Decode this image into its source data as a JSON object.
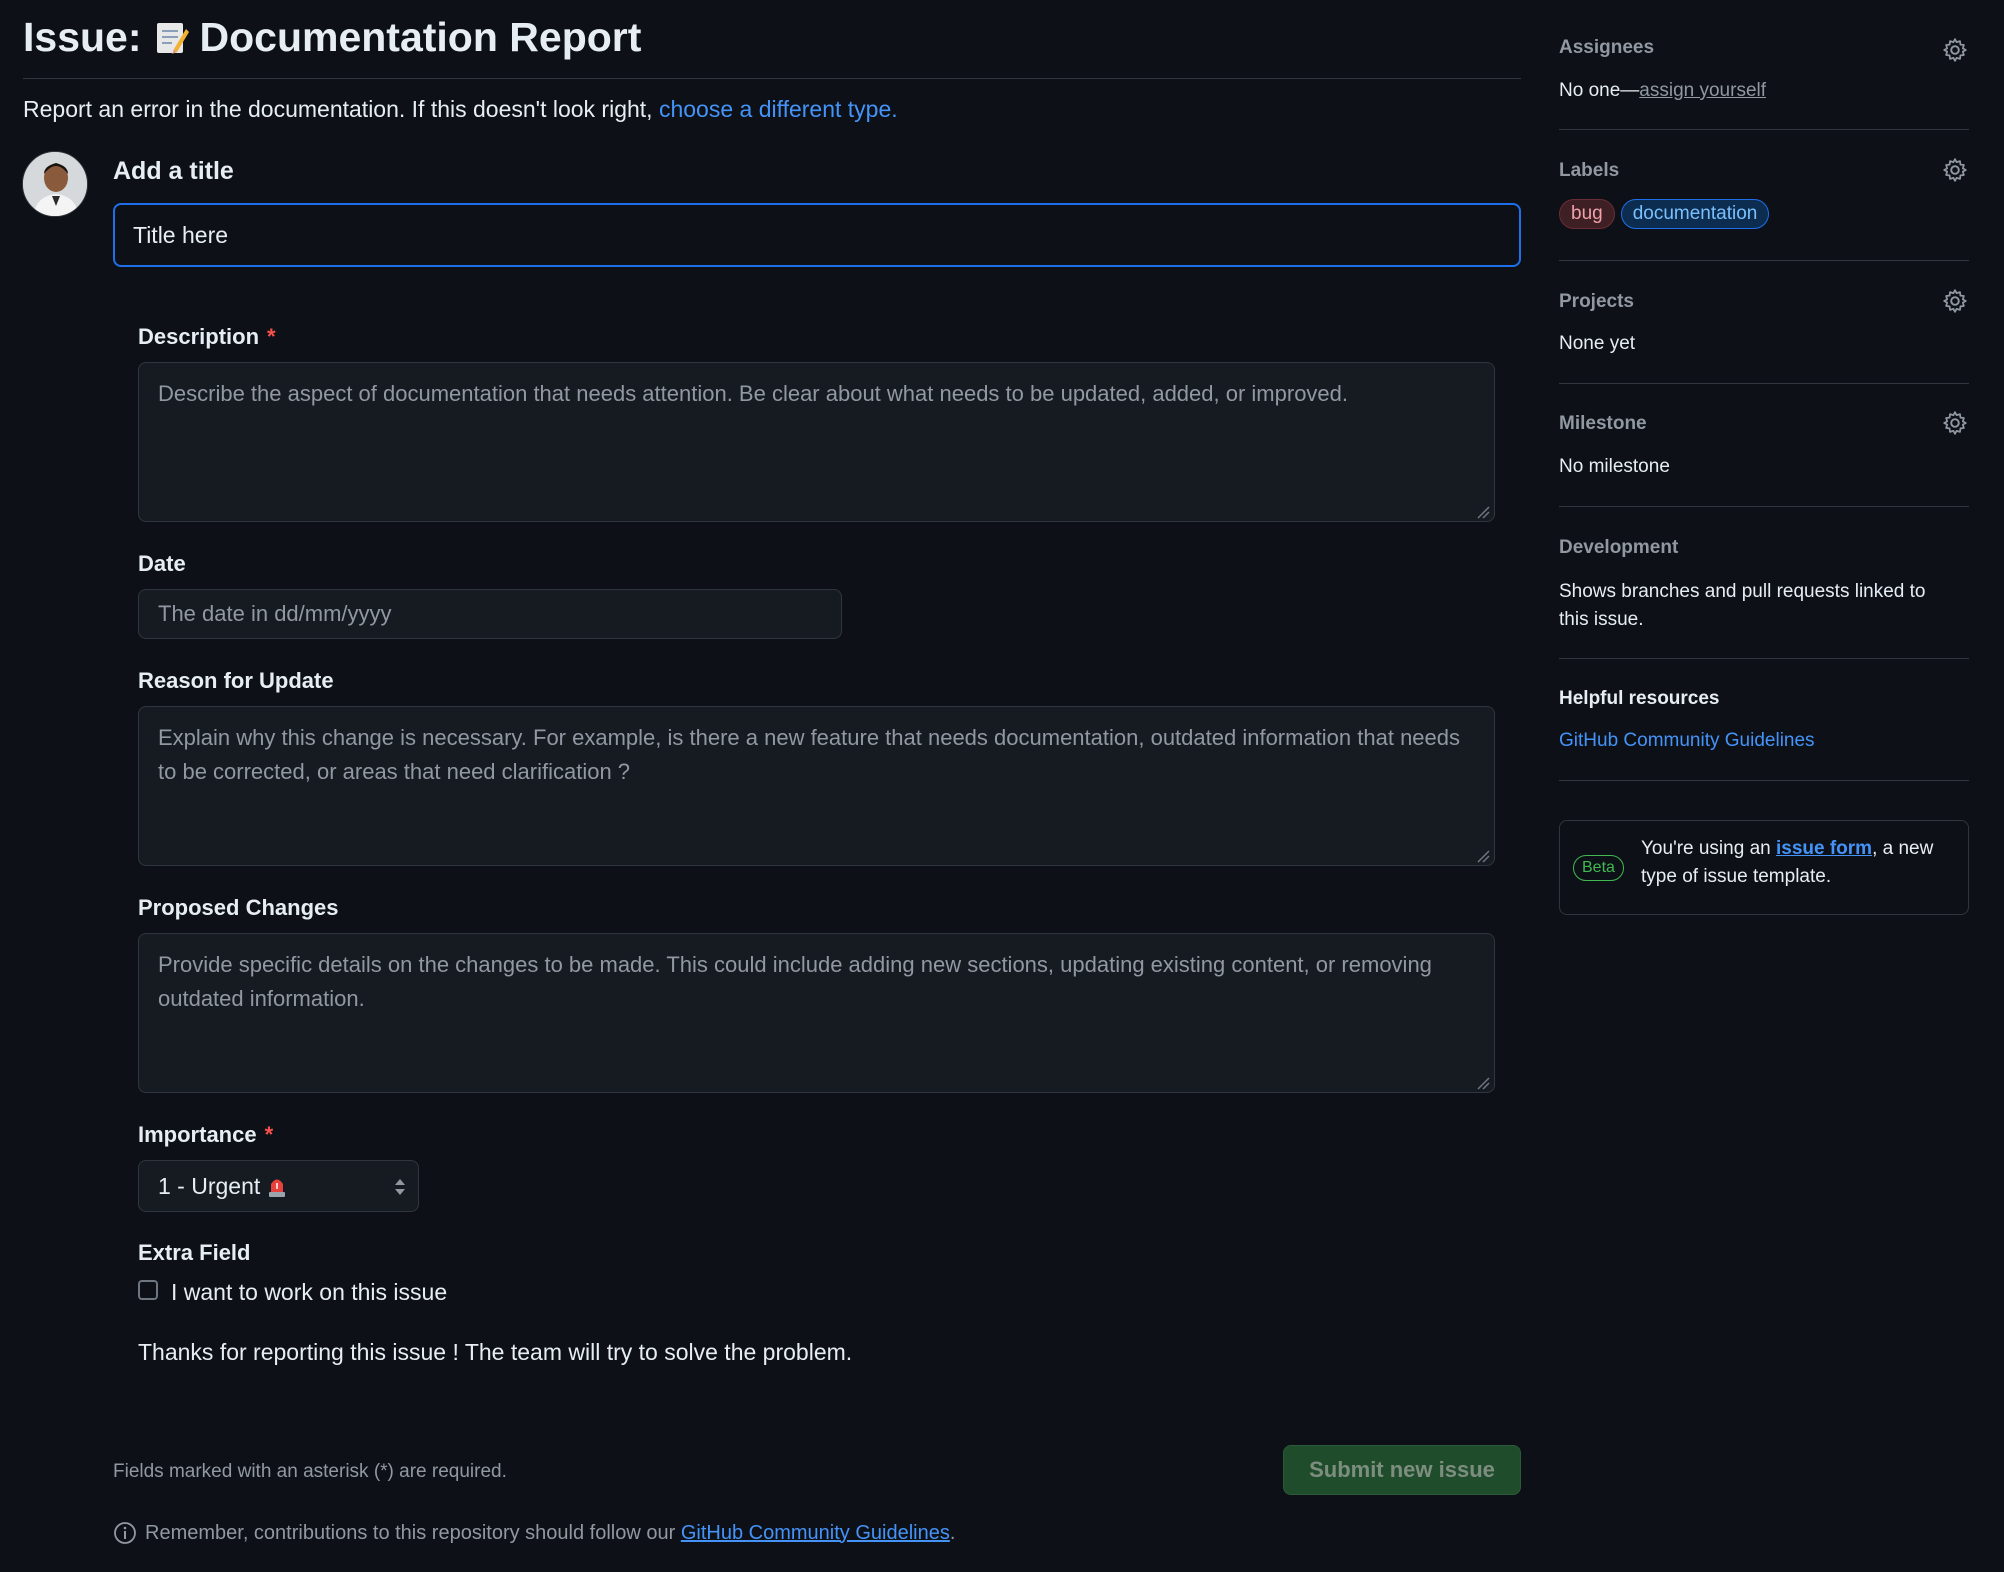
{
  "header": {
    "title_prefix": "Issue:",
    "title_emoji_icon": "memo-icon",
    "title_text": "Documentation Report",
    "subtitle": "Report an error in the documentation. If this doesn't look right,",
    "subtitle_link": "choose a different type."
  },
  "form": {
    "add_title_label": "Add a title",
    "title_value": "Title here",
    "description": {
      "label": "Description",
      "required_mark": "*",
      "placeholder": "Describe the aspect of documentation that needs attention. Be clear about what needs to be updated, added, or improved."
    },
    "date": {
      "label": "Date",
      "placeholder": "The date in dd/mm/yyyy"
    },
    "reason": {
      "label": "Reason for Update",
      "placeholder": "Explain why this change is necessary. For example, is there a new feature that needs documentation, outdated information that needs to be corrected, or areas that need clarification ?"
    },
    "proposed": {
      "label": "Proposed Changes",
      "placeholder": "Provide specific details on the changes to be made. This could include adding new sections, updating existing content, or removing outdated information."
    },
    "importance": {
      "label": "Importance",
      "required_mark": "*",
      "selected": "1 - Urgent",
      "selected_icon": "siren-icon"
    },
    "extra": {
      "label": "Extra Field",
      "checkbox_label": "I want to work on this issue",
      "checked": false
    },
    "thanks": "Thanks for reporting this issue ! The team will try to solve the problem.",
    "footnote": "Fields marked with an asterisk (*) are required.",
    "submit_label": "Submit new issue",
    "guidelines_prefix": "Remember, contributions to this repository should follow our",
    "guidelines_link": "GitHub Community Guidelines",
    "guidelines_suffix": "."
  },
  "sidebar": {
    "assignees": {
      "heading": "Assignees",
      "value_prefix": "No one—",
      "value_link": "assign yourself"
    },
    "labels": {
      "heading": "Labels",
      "items": [
        "bug",
        "documentation"
      ]
    },
    "projects": {
      "heading": "Projects",
      "value": "None yet"
    },
    "milestone": {
      "heading": "Milestone",
      "value": "No milestone"
    },
    "development": {
      "heading": "Development",
      "value_line1": "Shows branches and pull requests linked to",
      "value_line2": "this issue."
    },
    "resources": {
      "heading": "Helpful resources",
      "link": "GitHub Community Guidelines"
    },
    "beta": {
      "badge": "Beta",
      "text_prefix": "You're using an ",
      "link": "issue form",
      "text_suffix": ", a new type of issue template."
    }
  },
  "colors": {
    "background": "#0d1117",
    "accent_blue": "#4493f8",
    "required_red": "#f85149",
    "submit_green": "#1f4d2b"
  }
}
